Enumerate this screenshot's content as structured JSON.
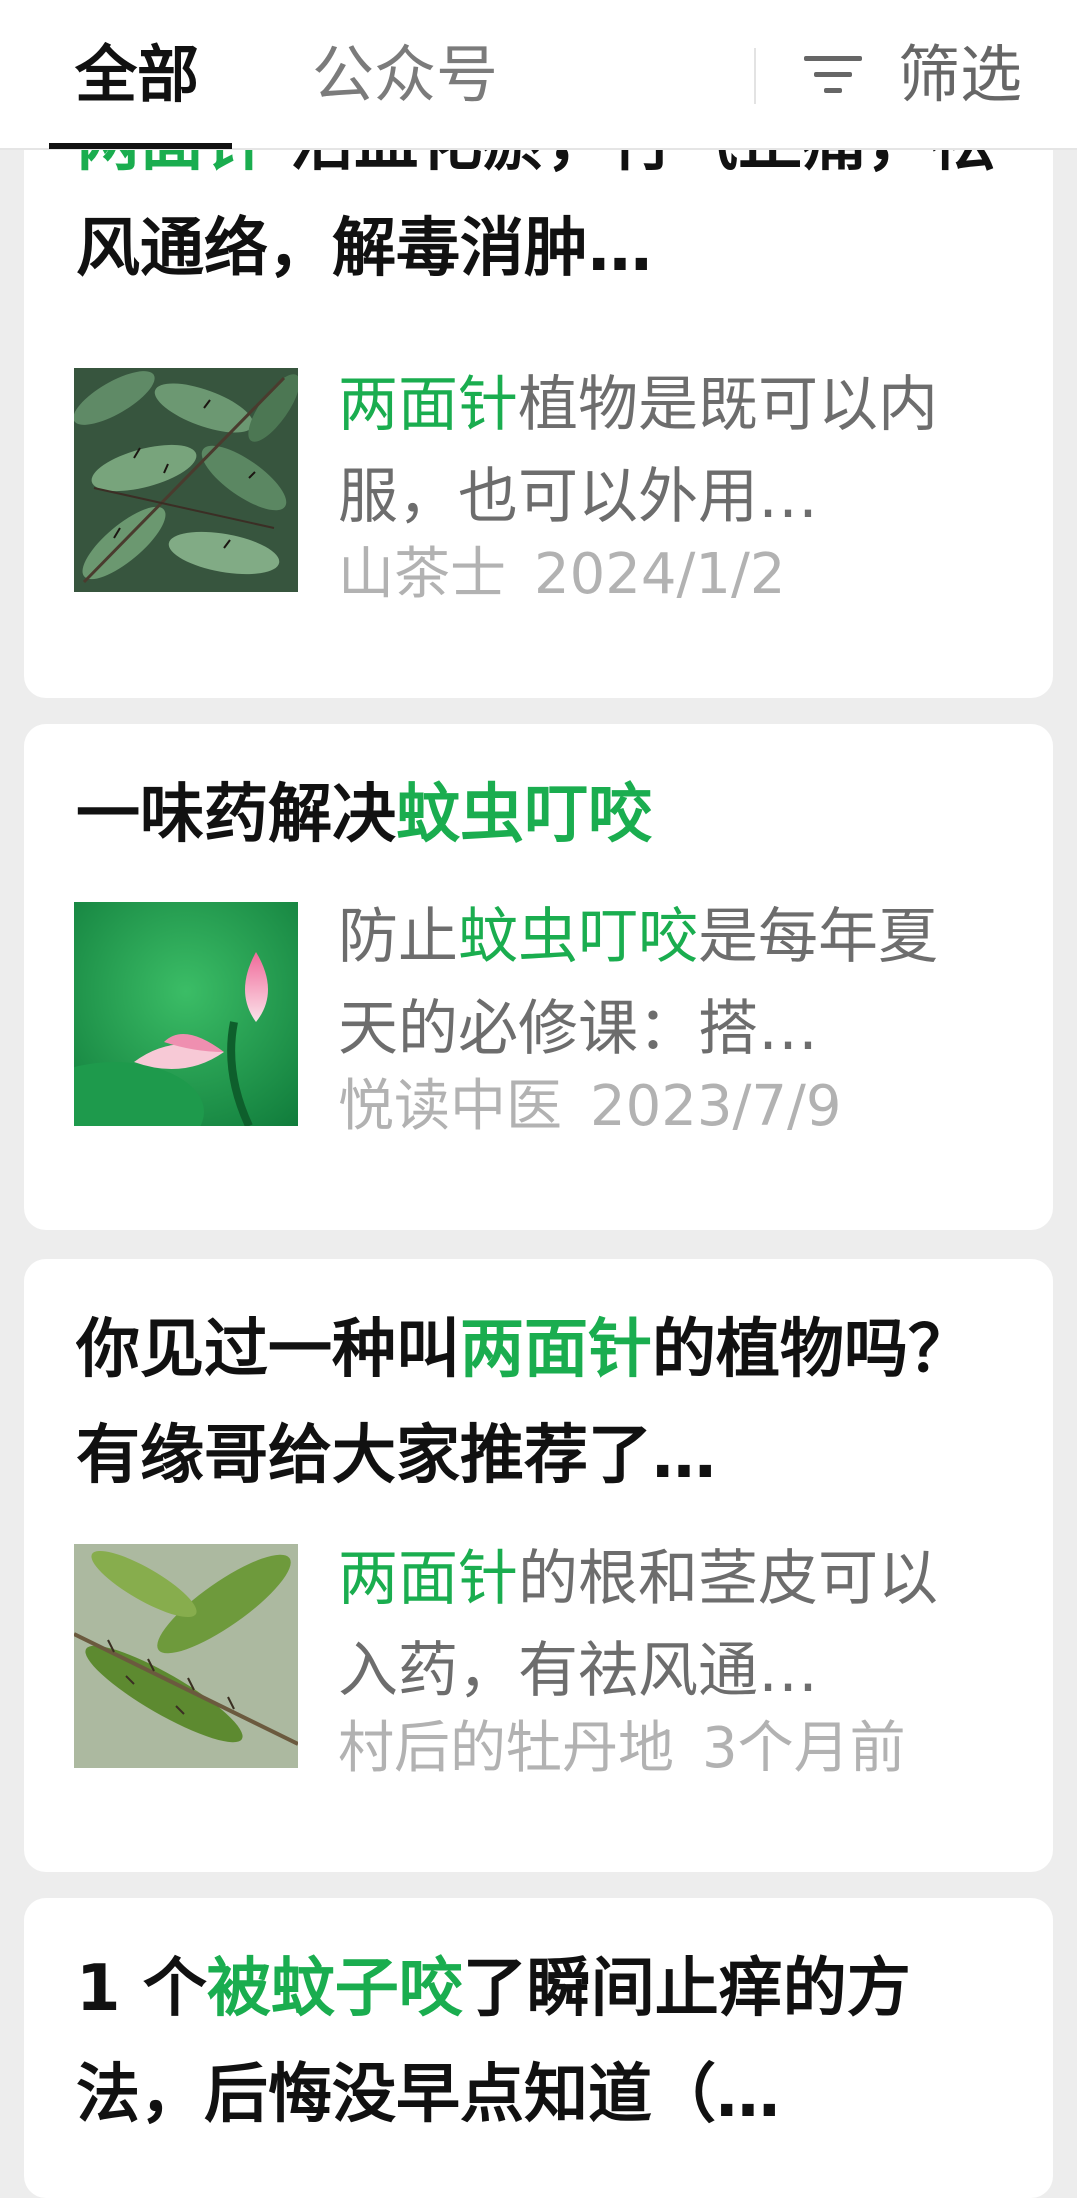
{
  "tabs": {
    "all": "全部",
    "official_accounts": "公众号",
    "filter": "筛选"
  },
  "results": [
    {
      "title_parts": [
        {
          "text": "两面针",
          "highlight": true
        },
        {
          "text": " 活血化瘀，行气止痛，祛风通络，解毒消肿…",
          "highlight": false
        }
      ],
      "snippet_parts": [
        {
          "text": "两面针",
          "highlight": true
        },
        {
          "text": "植物是既可以内服，也可以外用…",
          "highlight": false
        }
      ],
      "source": "山茶士",
      "date": "2024/1/2",
      "thumbnail": "thorny-leaves-photo"
    },
    {
      "title_parts": [
        {
          "text": "一味药解决",
          "highlight": false
        },
        {
          "text": "蚊虫叮咬",
          "highlight": true
        }
      ],
      "snippet_parts": [
        {
          "text": "防止",
          "highlight": false
        },
        {
          "text": "蚊虫叮咬",
          "highlight": true
        },
        {
          "text": "是每年夏天的必修课：搭…",
          "highlight": false
        }
      ],
      "source": "悦读中医",
      "date": "2023/7/9",
      "thumbnail": "lotus-bud-photo"
    },
    {
      "title_parts": [
        {
          "text": "你见过一种叫",
          "highlight": false
        },
        {
          "text": "两面针",
          "highlight": true
        },
        {
          "text": "的植物吗？有缘哥给大家推荐了…",
          "highlight": false
        }
      ],
      "snippet_parts": [
        {
          "text": "两面针",
          "highlight": true
        },
        {
          "text": "的根和茎皮可以入药，有祛风通…",
          "highlight": false
        }
      ],
      "source": "村后的牡丹地",
      "date": "3个月前",
      "thumbnail": "spiny-plant-photo"
    },
    {
      "title_parts": [
        {
          "text": "1 个",
          "highlight": false
        },
        {
          "text": "被蚊子咬",
          "highlight": true
        },
        {
          "text": "了瞬间止痒的方法，后悔没早点知道（…",
          "highlight": false
        }
      ]
    }
  ],
  "colors": {
    "highlight": "#1aad4f",
    "background": "#ededed",
    "card": "#ffffff",
    "meta": "#b2b2b2"
  }
}
